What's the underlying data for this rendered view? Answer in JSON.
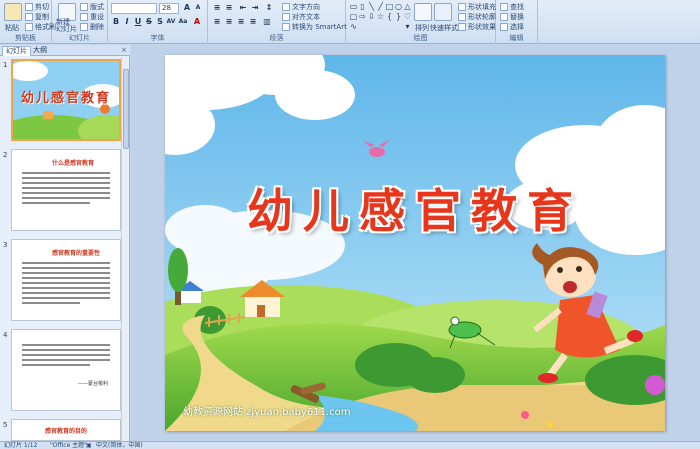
{
  "ribbon": {
    "clipboard": {
      "paste": "粘贴",
      "cut": "剪切",
      "copy": "复制",
      "format_painter": "格式刷",
      "label": "剪贴板"
    },
    "slides": {
      "new_slide": "新建\n幻灯片",
      "layout": "版式",
      "reset": "重设",
      "delete": "删除",
      "label": "幻灯片"
    },
    "font": {
      "font_name": "",
      "font_size": "28",
      "label": "字体",
      "bold": "B",
      "italic": "I",
      "underline": "U",
      "strike": "S",
      "shadow": "S",
      "spacing": "AV",
      "case": "Aa",
      "color": "A"
    },
    "paragraph": {
      "text_direction": "文字方向",
      "align_text": "对齐文本",
      "smartart": "转换为 SmartArt",
      "label": "段落"
    },
    "drawing": {
      "arrange": "排列",
      "quick_styles": "快速样式",
      "shape_fill": "形状填充",
      "shape_outline": "形状轮廓",
      "shape_effects": "形状效果",
      "label": "绘图"
    },
    "editing": {
      "find": "查找",
      "replace": "替换",
      "select": "选择",
      "label": "编辑"
    }
  },
  "left_panel": {
    "tabs": [
      "幻灯片",
      "大纲"
    ],
    "close": "×",
    "slides": [
      {
        "num": "1",
        "title": "幼儿感官教育"
      },
      {
        "num": "2",
        "title": "什么是感官教育"
      },
      {
        "num": "3",
        "title": "感官教育的重要性"
      },
      {
        "num": "4",
        "title": "",
        "author": "——蒙台梭利"
      },
      {
        "num": "5",
        "title": "感官教育的目的"
      }
    ]
  },
  "slide": {
    "title": "幼儿感官教育",
    "watermark": "幼教资源网站 zjyuan.baby611.com"
  },
  "statusbar": {
    "slide_info": "幻灯片 1/12",
    "theme": "\"Office 主题\"",
    "language": "中文(简体，中国)"
  },
  "colors": {
    "title_red": "#e8361c",
    "sky": "#7cc4ee",
    "grass": "#7dc843",
    "ribbon_bg": "#dbe7f6"
  }
}
